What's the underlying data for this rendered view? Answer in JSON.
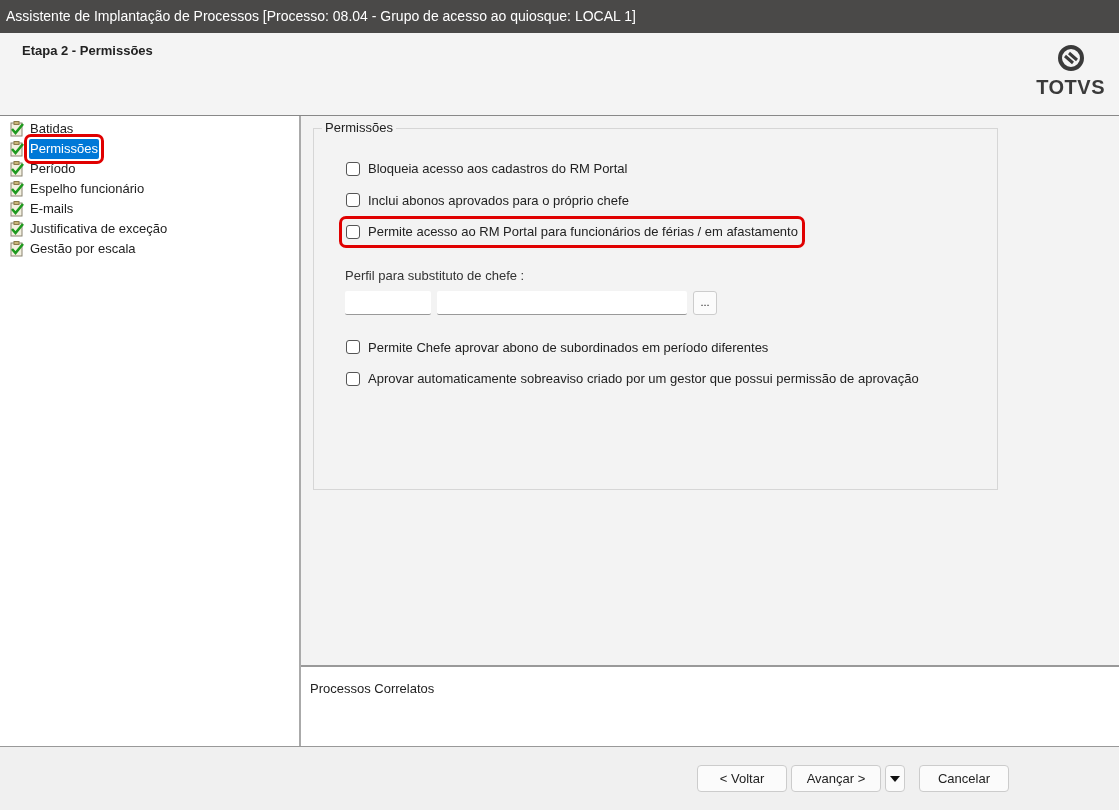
{
  "window": {
    "title": "Assistente de Implantação de Processos [Processo: 08.04 - Grupo de acesso ao quiosque: LOCAL 1]"
  },
  "header": {
    "step_title": "Etapa 2 - Permissões",
    "logo_text": "TOTVS"
  },
  "steps": [
    {
      "label": "Batidas",
      "selected": false,
      "highlighted": false
    },
    {
      "label": "Permissões",
      "selected": true,
      "highlighted": true
    },
    {
      "label": "Período",
      "selected": false,
      "highlighted": false
    },
    {
      "label": "Espelho funcionário",
      "selected": false,
      "highlighted": false
    },
    {
      "label": "E-mails",
      "selected": false,
      "highlighted": false
    },
    {
      "label": "Justificativa de exceção",
      "selected": false,
      "highlighted": false
    },
    {
      "label": "Gestão por escala",
      "selected": false,
      "highlighted": false
    }
  ],
  "group": {
    "title": "Permissões",
    "options_top": [
      {
        "label": "Bloqueia acesso aos cadastros do RM Portal",
        "checked": false,
        "highlighted": false
      },
      {
        "label": "Inclui abonos aprovados para o próprio chefe",
        "checked": false,
        "highlighted": false
      },
      {
        "label": "Permite acesso ao RM Portal para funcionários de férias / em afastamento",
        "checked": false,
        "highlighted": true
      }
    ],
    "profile": {
      "label": "Perfil para substituto de chefe :",
      "browse": "..."
    },
    "options_bottom": [
      {
        "label": "Permite Chefe aprovar abono de subordinados em período diferentes",
        "checked": false,
        "highlighted": false
      },
      {
        "label": "Aprovar automaticamente sobreaviso criado por um gestor que possui permissão de aprovação",
        "checked": false,
        "highlighted": false
      }
    ]
  },
  "related": {
    "title": "Processos Correlatos"
  },
  "buttons": {
    "back": "< Voltar",
    "next": "Avançar >",
    "cancel": "Cancelar"
  }
}
